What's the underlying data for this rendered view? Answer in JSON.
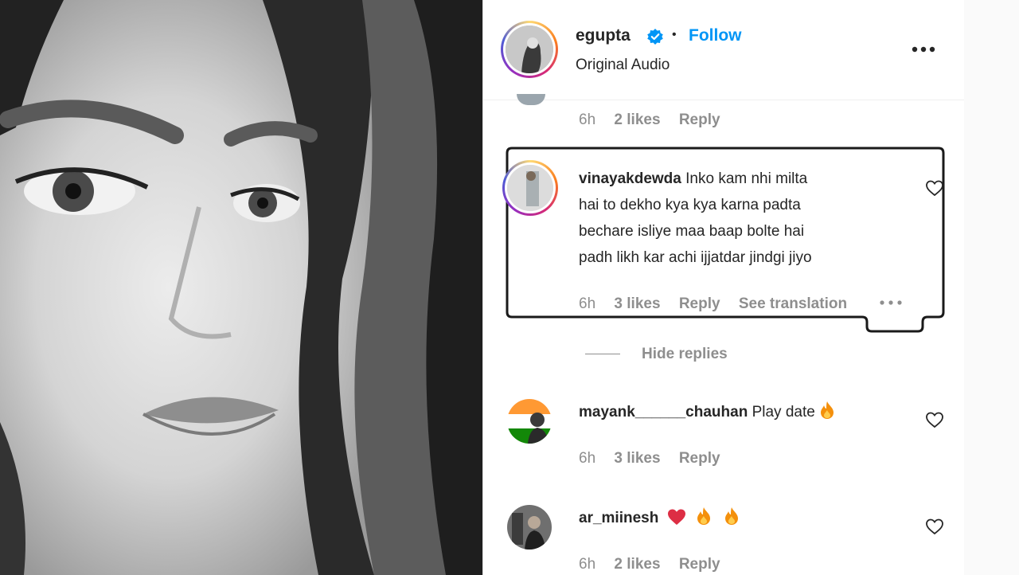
{
  "post": {
    "username": "egupta",
    "follow_label": "Follow",
    "separator": "•",
    "audio_label": "Original Audio"
  },
  "colors": {
    "link_blue": "#0095f6",
    "verified_blue": "#0095f6",
    "like_red": "#ed4956",
    "text": "#262626",
    "muted": "#8e8e8e"
  },
  "comments": [
    {
      "time": "6h",
      "likes": "2 likes",
      "reply": "Reply"
    },
    {
      "username": "vinayakdewda",
      "lines": [
        "Inko kam nhi milta",
        "hai to dekho kya kya karna padta",
        "bechare isliye maa baap bolte hai",
        "padh likh kar achi ijjatdar jindgi jiyo"
      ],
      "time": "6h",
      "likes": "3 likes",
      "reply": "Reply",
      "see_translation": "See translation"
    },
    {
      "hide_replies": "Hide replies"
    },
    {
      "username": "mayank______chauhan",
      "text": "Play date",
      "time": "6h",
      "likes": "3 likes",
      "reply": "Reply"
    },
    {
      "username": "ar_miinesh",
      "time": "6h",
      "likes": "2 likes",
      "reply": "Reply"
    }
  ],
  "icons": [
    "verified-badge-icon",
    "more-options-icon",
    "heart-outline-icon",
    "fire-emoji-icon",
    "red-heart-emoji-icon"
  ]
}
